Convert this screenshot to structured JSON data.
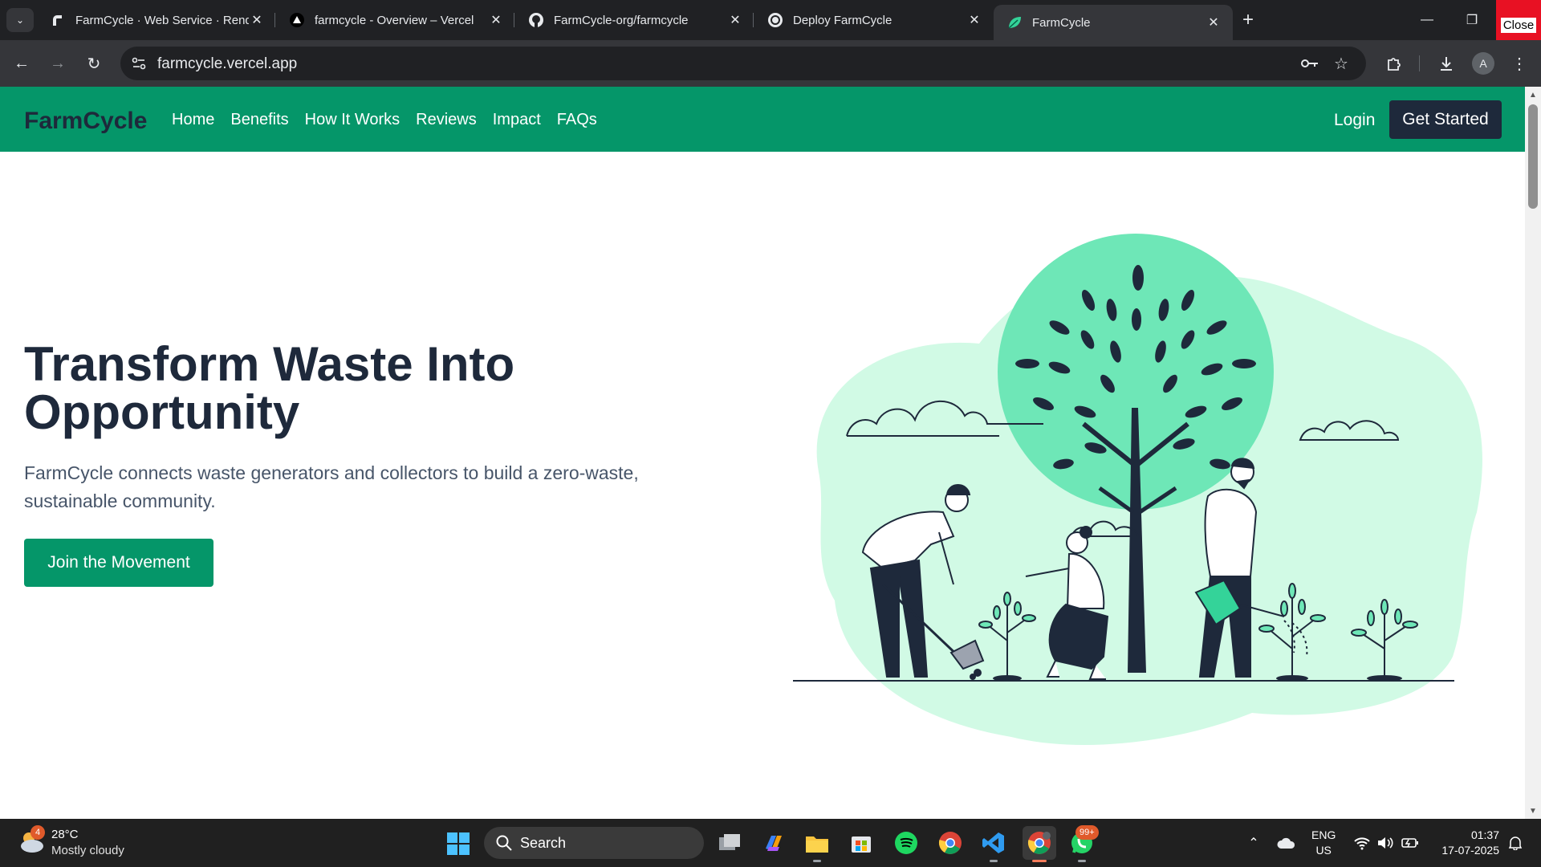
{
  "browser": {
    "tabs": [
      {
        "title": "FarmCycle · Web Service · Render",
        "icon": "render-icon"
      },
      {
        "title": "farmcycle - Overview – Vercel",
        "icon": "vercel-icon"
      },
      {
        "title": "FarmCycle-org/farmcycle",
        "icon": "github-icon"
      },
      {
        "title": "Deploy FarmCycle",
        "icon": "openai-icon"
      },
      {
        "title": "FarmCycle",
        "icon": "leaf-icon",
        "active": true
      }
    ],
    "url": "farmcycle.vercel.app",
    "close_label": "Close",
    "profile_initial": "A"
  },
  "site": {
    "brand": "FarmCycle",
    "nav": [
      "Home",
      "Benefits",
      "How It Works",
      "Reviews",
      "Impact",
      "FAQs"
    ],
    "login": "Login",
    "get_started": "Get Started",
    "colors": {
      "primary": "#059669",
      "dark": "#1e293b",
      "illustration_light": "#d1fae5",
      "illustration_mid": "#6ee7b7"
    }
  },
  "hero": {
    "title": "Transform Waste Into Opportunity",
    "subtitle": "FarmCycle connects waste generators and collectors to build a zero-waste, sustainable community.",
    "button": "Join the Movement"
  },
  "taskbar": {
    "weather_badge": "4",
    "temperature": "28°C",
    "condition": "Mostly cloudy",
    "search_label": "Search",
    "notification_badge": "99+",
    "lang_line1": "ENG",
    "lang_line2": "US",
    "time": "01:37",
    "date": "17-07-2025",
    "apps": [
      "task-view-icon",
      "copilot-icon",
      "file-explorer-icon",
      "store-icon",
      "spotify-icon",
      "chrome-icon",
      "vscode-icon",
      "chrome-profile-icon",
      "whatsapp-icon"
    ]
  }
}
